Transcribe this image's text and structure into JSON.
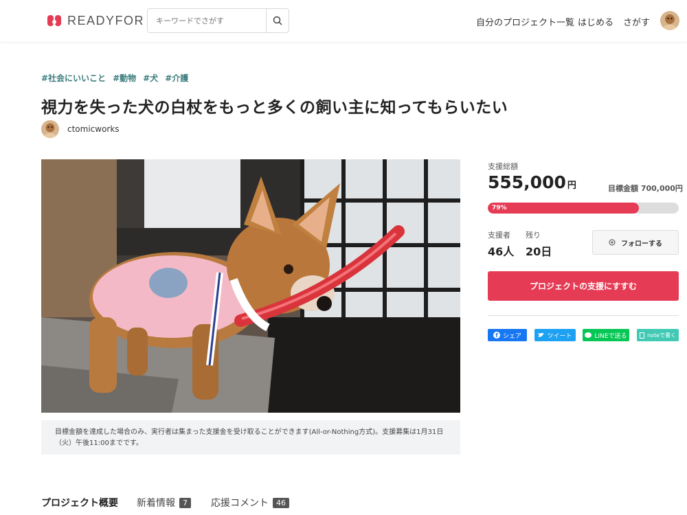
{
  "header": {
    "logo_text": "READYFOR",
    "search_placeholder": "キーワードでさがす",
    "nav": [
      "自分のプロジェクト一覧",
      "はじめる",
      "さがす"
    ]
  },
  "project": {
    "tags": [
      "#社会にいいこと",
      "#動物",
      "#犬",
      "#介護"
    ],
    "title": "視力を失った犬の白杖をもっと多くの飼い主に知ってもらいたい",
    "owner": "ctomicworks",
    "note": "目標金額を達成した場合のみ、実行者は集まった支援金を受け取ることができます(All-or-Nothing方式)。支援募集は1月31日（火）午後11:00までです。"
  },
  "stats": {
    "total_label": "支援総額",
    "total_value": "555,000",
    "unit": "円",
    "goal_text": "目標金額 700,000円",
    "progress_label": "79%",
    "progress_fraction": 0.79,
    "backers_label": "支援者",
    "backers_value": "46人",
    "remaining_label": "残り",
    "remaining_value": "20日",
    "follow_label": "フォローする",
    "support_label": "プロジェクトの支援にすすむ"
  },
  "share": {
    "facebook": "シェア",
    "twitter": "ツイート",
    "line": "LINEで送る",
    "note": "noteで書く"
  },
  "colors": {
    "accent": "#e63b55",
    "tag": "#3a7b7c",
    "facebook": "#1877f2",
    "twitter": "#1da1f2",
    "line": "#06c755",
    "note": "#41c9b4"
  },
  "tabs": [
    {
      "label": "プロジェクト概要",
      "badge": ""
    },
    {
      "label": "新着情報",
      "badge": "7"
    },
    {
      "label": "応援コメント",
      "badge": "46"
    }
  ]
}
